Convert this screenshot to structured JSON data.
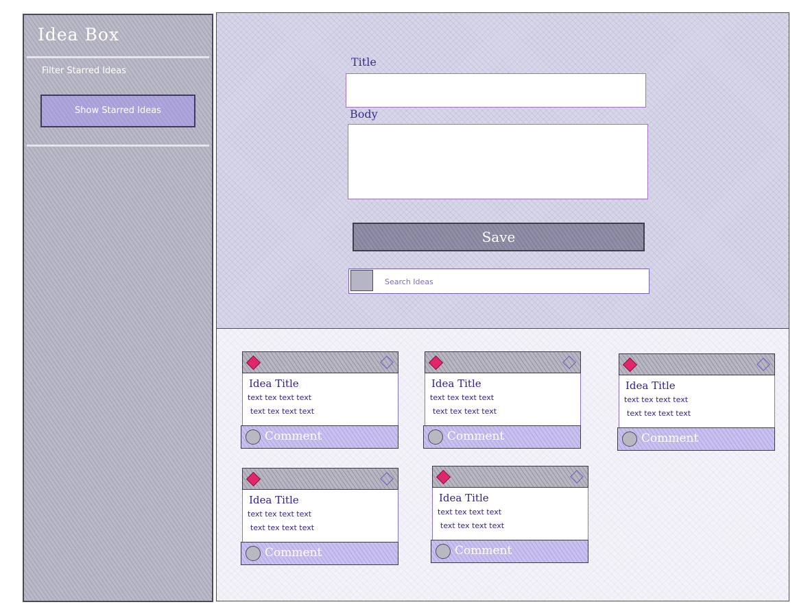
{
  "sidebar": {
    "title": "Idea Box",
    "filter_label": "Filter Starred Ideas",
    "show_starred_label": "Show Starred Ideas"
  },
  "form": {
    "title_label": "Title",
    "title_value": "",
    "body_label": "Body",
    "body_value": "",
    "save_label": "Save"
  },
  "search": {
    "placeholder": "Search Ideas",
    "value": ""
  },
  "cards": [
    {
      "title": "Idea Title",
      "line1": "text tex text text",
      "line2": "text tex text text",
      "comment_label": "Comment"
    },
    {
      "title": "Idea Title",
      "line1": "text tex text text",
      "line2": "text tex text text",
      "comment_label": "Comment"
    },
    {
      "title": "Idea Title",
      "line1": "text tex text text",
      "line2": "text tex text text",
      "comment_label": "Comment"
    },
    {
      "title": "Idea Title",
      "line1": "text tex text text",
      "line2": "text tex text text",
      "comment_label": "Comment"
    },
    {
      "title": "Idea Title",
      "line1": "text tex text text",
      "line2": "text tex text text",
      "comment_label": "Comment"
    }
  ],
  "colors": {
    "delete_icon": "#e0276a",
    "accent_purple": "#a89fd8",
    "text_purple": "#2f2290"
  },
  "icons": {
    "delete": "diamond-filled-icon",
    "star": "diamond-outline-icon",
    "comment": "circle-icon",
    "search": "square-icon"
  }
}
